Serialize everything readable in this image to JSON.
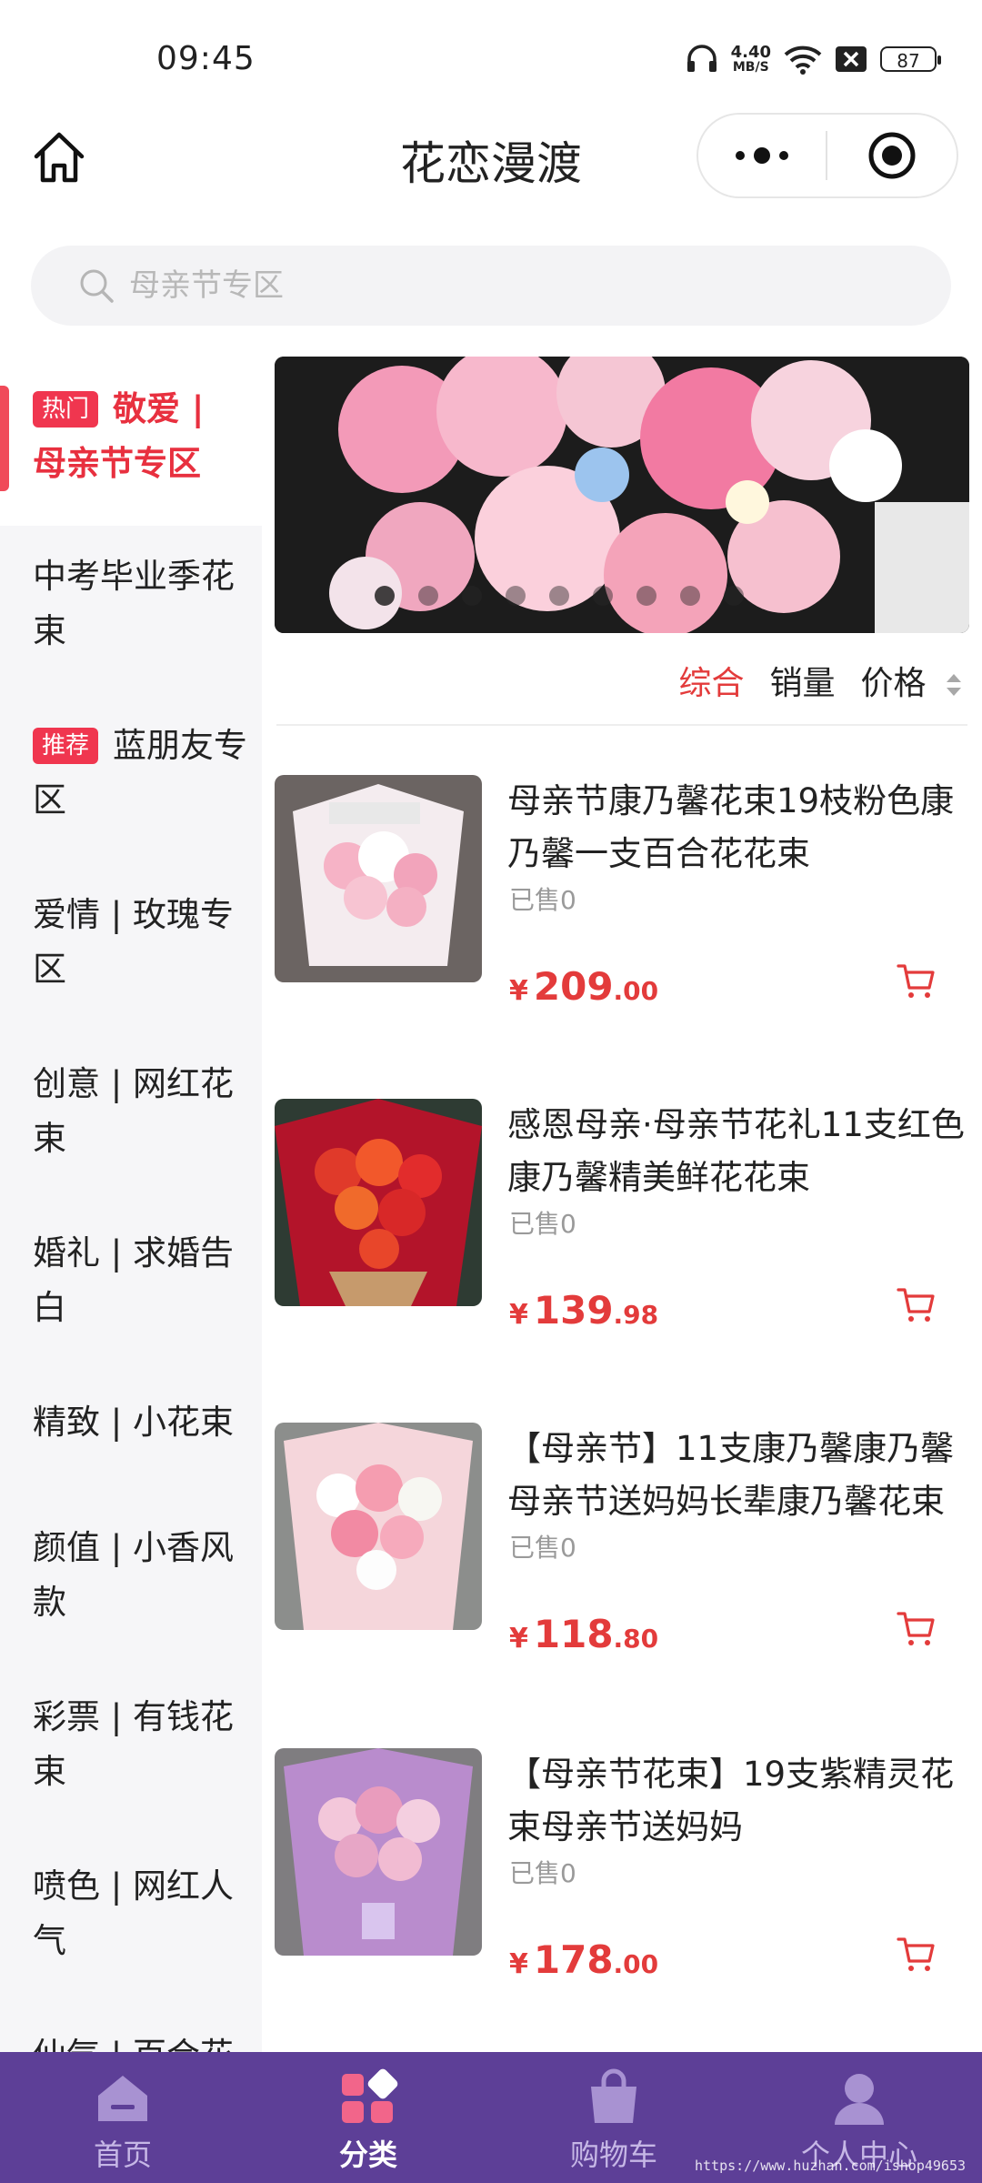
{
  "status": {
    "time": "09:45",
    "net_speed": "4.40",
    "net_unit": "MB/S",
    "battery": "87"
  },
  "header": {
    "title": "花恋漫渡"
  },
  "search": {
    "placeholder": "母亲节专区"
  },
  "sidebar": {
    "items": [
      {
        "tag": "热门",
        "label": "敬爱 | 母亲节专区"
      },
      {
        "label": "中考毕业季花束"
      },
      {
        "tag": "推荐",
        "label": "蓝朋友专区"
      },
      {
        "label": "爱情 | 玫瑰专区"
      },
      {
        "label": "创意 | 网红花束"
      },
      {
        "label": "婚礼 | 求婚告白"
      },
      {
        "label": "精致 | 小花束"
      },
      {
        "label": "颜值 | 小香风款"
      },
      {
        "label": "彩票 | 有钱花束"
      },
      {
        "label": "喷色 | 网红人气"
      },
      {
        "label": "仙气 | 百合花"
      }
    ]
  },
  "banner": {
    "dot_count": 9,
    "active_dot": 0
  },
  "sort": {
    "comprehensive": "综合",
    "sales": "销量",
    "price": "价格"
  },
  "products": [
    {
      "name": "母亲节康乃馨花束19枝粉色康乃馨一支百合花花束",
      "sold": "已售0",
      "currency": "¥",
      "price_int": "209",
      "price_dec": ".00"
    },
    {
      "name": "感恩母亲·母亲节花礼11支红色康乃馨精美鲜花花束",
      "sold": "已售0",
      "currency": "¥",
      "price_int": "139",
      "price_dec": ".98"
    },
    {
      "name": "【母亲节】11支康乃馨康乃馨母亲节送妈妈长辈康乃馨花束",
      "sold": "已售0",
      "currency": "¥",
      "price_int": "118",
      "price_dec": ".80"
    },
    {
      "name": "【母亲节花束】19支紫精灵花束母亲节送妈妈",
      "sold": "已售0",
      "currency": "¥",
      "price_int": "178",
      "price_dec": ".00"
    }
  ],
  "tabbar": {
    "home": "首页",
    "category": "分类",
    "cart": "购物车",
    "profile": "个人中心"
  },
  "watermark": "https://www.huzhan.com/ishop49653",
  "colors": {
    "accent": "#e33b3b",
    "tabbar": "#5d3f97",
    "sidebar_bg": "#f6f6f8"
  }
}
